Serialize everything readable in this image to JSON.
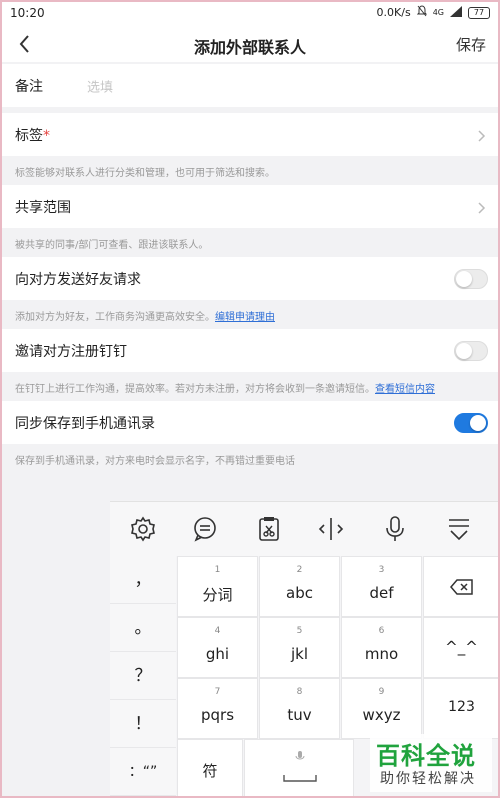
{
  "status_bar": {
    "time": "10:20",
    "network_speed": "0.0K/s",
    "signal": "4G",
    "battery": "77"
  },
  "nav": {
    "title": "添加外部联系人",
    "save_label": "保存"
  },
  "form": {
    "remark_label": "备注",
    "remark_placeholder": "选填",
    "tags_label": "标签",
    "tags_required_mark": "*",
    "tags_hint": "标签能够对联系人进行分类和管理，也可用于筛选和搜索。",
    "share_label": "共享范围",
    "share_hint": "被共享的同事/部门可查看、跟进该联系人。",
    "friend_request_label": "向对方发送好友请求",
    "friend_request_on": false,
    "friend_request_hint": "添加对方为好友，工作商务沟通更高效安全。",
    "friend_request_link": "编辑申请理由",
    "invite_label": "邀请对方注册钉钉",
    "invite_on": false,
    "invite_hint": "在钉钉上进行工作沟通，提高效率。若对方未注册，对方将会收到一条邀请短信。",
    "invite_link": "查看短信内容",
    "sync_label": "同步保存到手机通讯录",
    "sync_on": true,
    "sync_hint": "保存到手机通讯录，对方来电时会显示名字，不再错过重要电话",
    "accent_color": "#1f7ae0"
  },
  "keyboard": {
    "tools": [
      "settings-icon",
      "emoji-icon",
      "clipboard-icon",
      "cursor-icon",
      "microphone-icon",
      "hide-keyboard-icon"
    ],
    "symbols": [
      "，",
      "。",
      "？",
      "！",
      "：“”"
    ],
    "keys": [
      {
        "num": "1",
        "label": "分词"
      },
      {
        "num": "2",
        "label": "abc"
      },
      {
        "num": "3",
        "label": "def"
      },
      {
        "num": "4",
        "label": "ghi"
      },
      {
        "num": "5",
        "label": "jkl"
      },
      {
        "num": "6",
        "label": "mno"
      },
      {
        "num": "7",
        "label": "pqrs"
      },
      {
        "num": "8",
        "label": "tuv"
      },
      {
        "num": "9",
        "label": "wxyz"
      }
    ],
    "side_keys": {
      "emoticon": "^_^",
      "numbers": "123"
    },
    "bottom": {
      "symbols_key": "符"
    }
  },
  "watermark": {
    "title": "百科全说",
    "subtitle": "助你轻松解决"
  }
}
